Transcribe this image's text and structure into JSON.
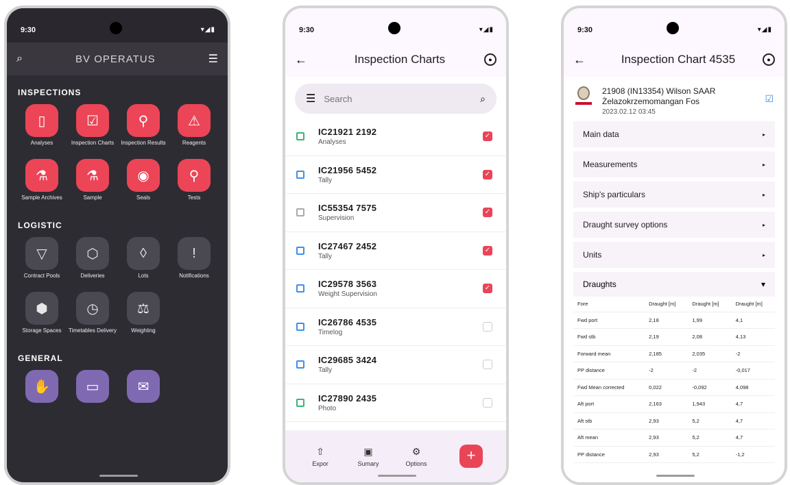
{
  "status": {
    "time": "9:30"
  },
  "phone1": {
    "title": "BV OPERATUS",
    "sections": [
      {
        "title": "INSPECTIONS",
        "items": [
          {
            "label": "Analyses",
            "icon": "analyses-icon",
            "glyph": "▯"
          },
          {
            "label": "Inspection Charts",
            "icon": "inspection-charts-icon",
            "glyph": "☑"
          },
          {
            "label": "Inspection Results",
            "icon": "inspection-results-icon",
            "glyph": "⚲"
          },
          {
            "label": "Reagents",
            "icon": "reagents-icon",
            "glyph": "⚠"
          },
          {
            "label": "Sample Archives",
            "icon": "sample-archives-icon",
            "glyph": "⚗"
          },
          {
            "label": "Sample",
            "icon": "sample-icon",
            "glyph": "⚗"
          },
          {
            "label": "Seals",
            "icon": "seals-icon",
            "glyph": "◉"
          },
          {
            "label": "Tests",
            "icon": "tests-icon",
            "glyph": "⚲"
          }
        ]
      },
      {
        "title": "LOGISTIC",
        "items": [
          {
            "label": "Contract Pools",
            "icon": "contract-pools-icon",
            "glyph": "▽"
          },
          {
            "label": "Deliveries",
            "icon": "deliveries-icon",
            "glyph": "⬡"
          },
          {
            "label": "Lots",
            "icon": "lots-icon",
            "glyph": "◊"
          },
          {
            "label": "Notifications",
            "icon": "notifications-icon",
            "glyph": "!"
          },
          {
            "label": "Storage Spaces",
            "icon": "storage-spaces-icon",
            "glyph": "⬢"
          },
          {
            "label": "Timetables Delivery",
            "icon": "clock-icon",
            "glyph": "◷"
          },
          {
            "label": "Weighting",
            "icon": "scales-icon",
            "glyph": "⚖"
          }
        ]
      },
      {
        "title": "GENERAL",
        "items": [
          {
            "label": "",
            "icon": "handshake-icon",
            "glyph": "✋"
          },
          {
            "label": "",
            "icon": "folder-icon",
            "glyph": "▭"
          },
          {
            "label": "",
            "icon": "mail-icon",
            "glyph": "✉"
          }
        ]
      }
    ]
  },
  "phone2": {
    "title": "Inspection Charts",
    "search_placeholder": "Search",
    "rows": [
      {
        "code": "IC21921 2192",
        "sub": "Analyses",
        "icon": "green",
        "checked": true
      },
      {
        "code": "IC21956 5452",
        "sub": "Tally",
        "icon": "blue",
        "checked": true
      },
      {
        "code": "IC55354 7575",
        "sub": "Supervision",
        "icon": "grey",
        "checked": true
      },
      {
        "code": "IC27467 2452",
        "sub": "Tally",
        "icon": "blue",
        "checked": true
      },
      {
        "code": "IC29578 3563",
        "sub": "Weight Supervision",
        "icon": "blue",
        "checked": true
      },
      {
        "code": "IC26786 4535",
        "sub": "Timelog",
        "icon": "blue",
        "checked": false
      },
      {
        "code": "IC29685 3424",
        "sub": "Tally",
        "icon": "blue",
        "checked": false
      },
      {
        "code": "IC27890 2435",
        "sub": "Photo",
        "icon": "green",
        "checked": false
      }
    ],
    "bottom": {
      "export": "Expor",
      "summary": "Sumary",
      "options": "Options"
    },
    "fab": "+"
  },
  "phone3": {
    "title": "Inspection Chart 4535",
    "header": {
      "line1": "21908 (IN13354) Wilson SAAR",
      "line2": "Żelazokrzemomangan Fos",
      "line3": "2023.02.12   03:45"
    },
    "sections": [
      "Main data",
      "Measurements",
      "Ship's particulars",
      "Draught survey options",
      "Units"
    ],
    "draughts_title": "Draughts",
    "table": {
      "columns": [
        "Fore",
        "Draught [m]",
        "Draught [m]",
        "Draught [m]"
      ],
      "rows": [
        [
          "Fwd port",
          "2,18",
          "1,99",
          "4,1"
        ],
        [
          "Fwd stb",
          "2,19",
          "2,08",
          "4,13"
        ],
        [
          "Forward mean",
          "2,185",
          "2,035",
          "-2"
        ],
        [
          "PP distance",
          "-2",
          "-2",
          "-0,017"
        ],
        [
          "Fwd Mean corrected",
          "0,022",
          "-0,092",
          "4,098"
        ],
        [
          "Aft port",
          "2,163",
          "1,943",
          "4,7"
        ],
        [
          "Aft stb",
          "2,93",
          "5,2",
          "4,7"
        ],
        [
          "Aft mean",
          "2,93",
          "5,2",
          "4,7"
        ],
        [
          "PP distance",
          "2,93",
          "5,2",
          "-1,2"
        ]
      ]
    }
  },
  "colors": {
    "accent_red": "#ec4557",
    "dark_bg": "#2e2c33",
    "purple": "#7f6ab2",
    "blue": "#3c90ea",
    "green": "#3cb371"
  }
}
